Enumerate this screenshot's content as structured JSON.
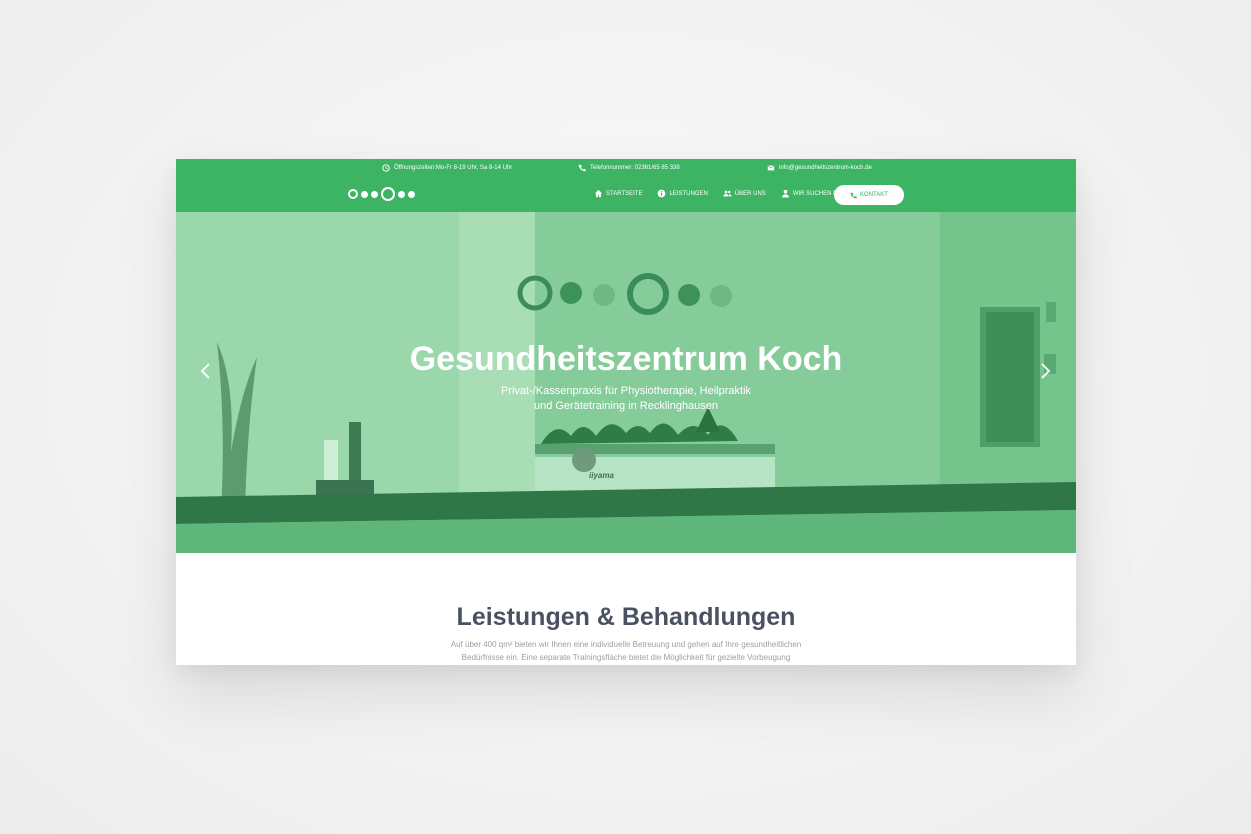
{
  "topbar": {
    "hours": "Öffnungszeiten:Mo-Fr 8-19 Uhr, Sa 8-14 Uhr",
    "phone": "Telefonnummer: 02361/65 85 338",
    "email": "info@gesundheitszentrum-koch.de"
  },
  "nav": {
    "items": [
      {
        "label": "STARTSEITE",
        "icon": "home-icon"
      },
      {
        "label": "LEISTUNGEN",
        "icon": "info-icon"
      },
      {
        "label": "ÜBER UNS",
        "icon": "group-icon"
      },
      {
        "label": "WIR SUCHEN DICH!",
        "icon": "person-icon"
      }
    ],
    "contact_label": "KONTAKT"
  },
  "hero": {
    "title": "Gesundheitszentrum Koch",
    "subtitle_line1": "Privat-/Kassenpraxis für Physiotherapie, Heilpraktik",
    "subtitle_line2": "und Gerätetraining in Recklinghausen",
    "monitor_label": "iiyama"
  },
  "section": {
    "title": "Leistungen & Behandlungen",
    "text_line1": "Auf über 400 qm² bieten wir Ihnen eine individuelle Betreuung und gehen auf Ihre gesundheitlichen",
    "text_line2": "Bedürfnisse ein. Eine separate Trainingsfläche bietet die Möglichkeit für gezielte Vorbeugung"
  },
  "colors": {
    "brand_green": "#3db364",
    "heading": "#4a5262",
    "body_text": "#9aa0a6"
  }
}
